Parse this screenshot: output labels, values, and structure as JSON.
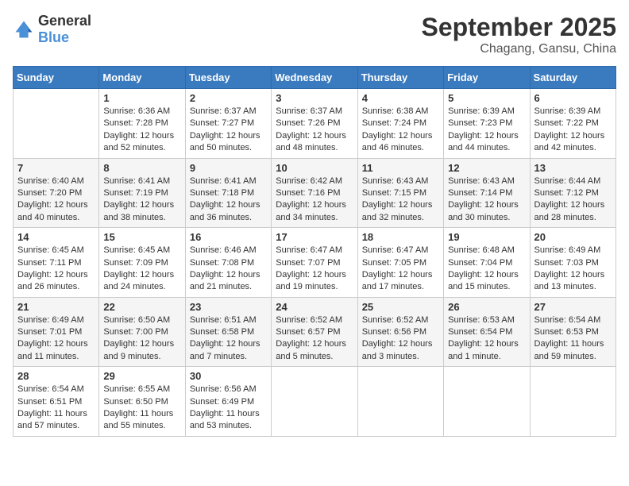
{
  "header": {
    "logo_general": "General",
    "logo_blue": "Blue",
    "month": "September 2025",
    "location": "Chagang, Gansu, China"
  },
  "weekdays": [
    "Sunday",
    "Monday",
    "Tuesday",
    "Wednesday",
    "Thursday",
    "Friday",
    "Saturday"
  ],
  "weeks": [
    [
      {
        "day": "",
        "sunrise": "",
        "sunset": "",
        "daylight": ""
      },
      {
        "day": "1",
        "sunrise": "Sunrise: 6:36 AM",
        "sunset": "Sunset: 7:28 PM",
        "daylight": "Daylight: 12 hours and 52 minutes."
      },
      {
        "day": "2",
        "sunrise": "Sunrise: 6:37 AM",
        "sunset": "Sunset: 7:27 PM",
        "daylight": "Daylight: 12 hours and 50 minutes."
      },
      {
        "day": "3",
        "sunrise": "Sunrise: 6:37 AM",
        "sunset": "Sunset: 7:26 PM",
        "daylight": "Daylight: 12 hours and 48 minutes."
      },
      {
        "day": "4",
        "sunrise": "Sunrise: 6:38 AM",
        "sunset": "Sunset: 7:24 PM",
        "daylight": "Daylight: 12 hours and 46 minutes."
      },
      {
        "day": "5",
        "sunrise": "Sunrise: 6:39 AM",
        "sunset": "Sunset: 7:23 PM",
        "daylight": "Daylight: 12 hours and 44 minutes."
      },
      {
        "day": "6",
        "sunrise": "Sunrise: 6:39 AM",
        "sunset": "Sunset: 7:22 PM",
        "daylight": "Daylight: 12 hours and 42 minutes."
      }
    ],
    [
      {
        "day": "7",
        "sunrise": "Sunrise: 6:40 AM",
        "sunset": "Sunset: 7:20 PM",
        "daylight": "Daylight: 12 hours and 40 minutes."
      },
      {
        "day": "8",
        "sunrise": "Sunrise: 6:41 AM",
        "sunset": "Sunset: 7:19 PM",
        "daylight": "Daylight: 12 hours and 38 minutes."
      },
      {
        "day": "9",
        "sunrise": "Sunrise: 6:41 AM",
        "sunset": "Sunset: 7:18 PM",
        "daylight": "Daylight: 12 hours and 36 minutes."
      },
      {
        "day": "10",
        "sunrise": "Sunrise: 6:42 AM",
        "sunset": "Sunset: 7:16 PM",
        "daylight": "Daylight: 12 hours and 34 minutes."
      },
      {
        "day": "11",
        "sunrise": "Sunrise: 6:43 AM",
        "sunset": "Sunset: 7:15 PM",
        "daylight": "Daylight: 12 hours and 32 minutes."
      },
      {
        "day": "12",
        "sunrise": "Sunrise: 6:43 AM",
        "sunset": "Sunset: 7:14 PM",
        "daylight": "Daylight: 12 hours and 30 minutes."
      },
      {
        "day": "13",
        "sunrise": "Sunrise: 6:44 AM",
        "sunset": "Sunset: 7:12 PM",
        "daylight": "Daylight: 12 hours and 28 minutes."
      }
    ],
    [
      {
        "day": "14",
        "sunrise": "Sunrise: 6:45 AM",
        "sunset": "Sunset: 7:11 PM",
        "daylight": "Daylight: 12 hours and 26 minutes."
      },
      {
        "day": "15",
        "sunrise": "Sunrise: 6:45 AM",
        "sunset": "Sunset: 7:09 PM",
        "daylight": "Daylight: 12 hours and 24 minutes."
      },
      {
        "day": "16",
        "sunrise": "Sunrise: 6:46 AM",
        "sunset": "Sunset: 7:08 PM",
        "daylight": "Daylight: 12 hours and 21 minutes."
      },
      {
        "day": "17",
        "sunrise": "Sunrise: 6:47 AM",
        "sunset": "Sunset: 7:07 PM",
        "daylight": "Daylight: 12 hours and 19 minutes."
      },
      {
        "day": "18",
        "sunrise": "Sunrise: 6:47 AM",
        "sunset": "Sunset: 7:05 PM",
        "daylight": "Daylight: 12 hours and 17 minutes."
      },
      {
        "day": "19",
        "sunrise": "Sunrise: 6:48 AM",
        "sunset": "Sunset: 7:04 PM",
        "daylight": "Daylight: 12 hours and 15 minutes."
      },
      {
        "day": "20",
        "sunrise": "Sunrise: 6:49 AM",
        "sunset": "Sunset: 7:03 PM",
        "daylight": "Daylight: 12 hours and 13 minutes."
      }
    ],
    [
      {
        "day": "21",
        "sunrise": "Sunrise: 6:49 AM",
        "sunset": "Sunset: 7:01 PM",
        "daylight": "Daylight: 12 hours and 11 minutes."
      },
      {
        "day": "22",
        "sunrise": "Sunrise: 6:50 AM",
        "sunset": "Sunset: 7:00 PM",
        "daylight": "Daylight: 12 hours and 9 minutes."
      },
      {
        "day": "23",
        "sunrise": "Sunrise: 6:51 AM",
        "sunset": "Sunset: 6:58 PM",
        "daylight": "Daylight: 12 hours and 7 minutes."
      },
      {
        "day": "24",
        "sunrise": "Sunrise: 6:52 AM",
        "sunset": "Sunset: 6:57 PM",
        "daylight": "Daylight: 12 hours and 5 minutes."
      },
      {
        "day": "25",
        "sunrise": "Sunrise: 6:52 AM",
        "sunset": "Sunset: 6:56 PM",
        "daylight": "Daylight: 12 hours and 3 minutes."
      },
      {
        "day": "26",
        "sunrise": "Sunrise: 6:53 AM",
        "sunset": "Sunset: 6:54 PM",
        "daylight": "Daylight: 12 hours and 1 minute."
      },
      {
        "day": "27",
        "sunrise": "Sunrise: 6:54 AM",
        "sunset": "Sunset: 6:53 PM",
        "daylight": "Daylight: 11 hours and 59 minutes."
      }
    ],
    [
      {
        "day": "28",
        "sunrise": "Sunrise: 6:54 AM",
        "sunset": "Sunset: 6:51 PM",
        "daylight": "Daylight: 11 hours and 57 minutes."
      },
      {
        "day": "29",
        "sunrise": "Sunrise: 6:55 AM",
        "sunset": "Sunset: 6:50 PM",
        "daylight": "Daylight: 11 hours and 55 minutes."
      },
      {
        "day": "30",
        "sunrise": "Sunrise: 6:56 AM",
        "sunset": "Sunset: 6:49 PM",
        "daylight": "Daylight: 11 hours and 53 minutes."
      },
      {
        "day": "",
        "sunrise": "",
        "sunset": "",
        "daylight": ""
      },
      {
        "day": "",
        "sunrise": "",
        "sunset": "",
        "daylight": ""
      },
      {
        "day": "",
        "sunrise": "",
        "sunset": "",
        "daylight": ""
      },
      {
        "day": "",
        "sunrise": "",
        "sunset": "",
        "daylight": ""
      }
    ]
  ]
}
